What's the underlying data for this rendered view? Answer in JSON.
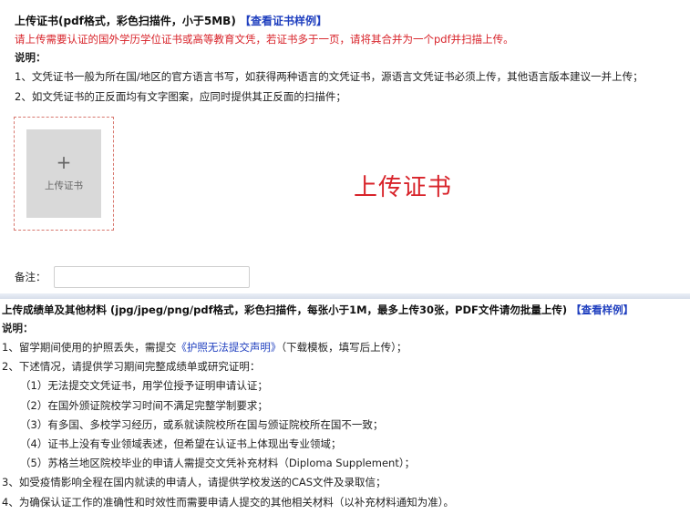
{
  "cert": {
    "title": "上传证书(pdf格式，彩色扫描件，小于5MB)",
    "sample_link": "【查看证书样例】",
    "warning": "请上传需要认证的国外学历学位证书或高等教育文凭，若证书多于一页，请将其合并为一个pdf并扫描上传。",
    "note_label": "说明：",
    "notes": [
      "1、文凭证书一般为所在国/地区的官方语言书写，如获得两种语言的文凭证书，源语言文凭证书必须上传，其他语言版本建议一并上传；",
      "2、如文凭证书的正反面均有文字图案，应同时提供其正反面的扫描件；"
    ],
    "upload_plus": "+",
    "upload_label": "上传证书",
    "big_title": "上传证书",
    "remark_label": "备注：",
    "remark_value": "",
    "remark_placeholder": ""
  },
  "transcript": {
    "title": "上传成绩单及其他材料 (jpg/jpeg/png/pdf格式，彩色扫描件，每张小于1M，最多上传30张，PDF文件请勿批量上传)",
    "sample_link": "【查看样例】",
    "note_label": "说明：",
    "item1_prefix": "1、留学期间使用的护照丢失，需提交",
    "item1_link": "《护照无法提交声明》",
    "item1_suffix": "（下载模板，填写后上传）；",
    "item2": "2、下述情况，请提供学习期间完整成绩单或研究证明：",
    "sub_items": [
      "（1）无法提交文凭证书，用学位授予证明申请认证；",
      "（2）在国外颁证院校学习时间不满足完整学制要求；",
      "（3）有多国、多校学习经历，或系就读院校所在国与颁证院校所在国不一致；",
      "（4）证书上没有专业领域表述，但希望在认证书上体现出专业领域；",
      "（5）苏格兰地区院校毕业的申请人需提交文凭补充材料（Diploma Supplement）；"
    ],
    "item3": "3、如受疫情影响全程在国内就读的申请人，请提供学校发送的CAS文件及录取信；",
    "item4": "4、为确保认证工作的准确性和时效性而需要申请人提交的其他相关材料（以补充材料通知为准）。"
  }
}
